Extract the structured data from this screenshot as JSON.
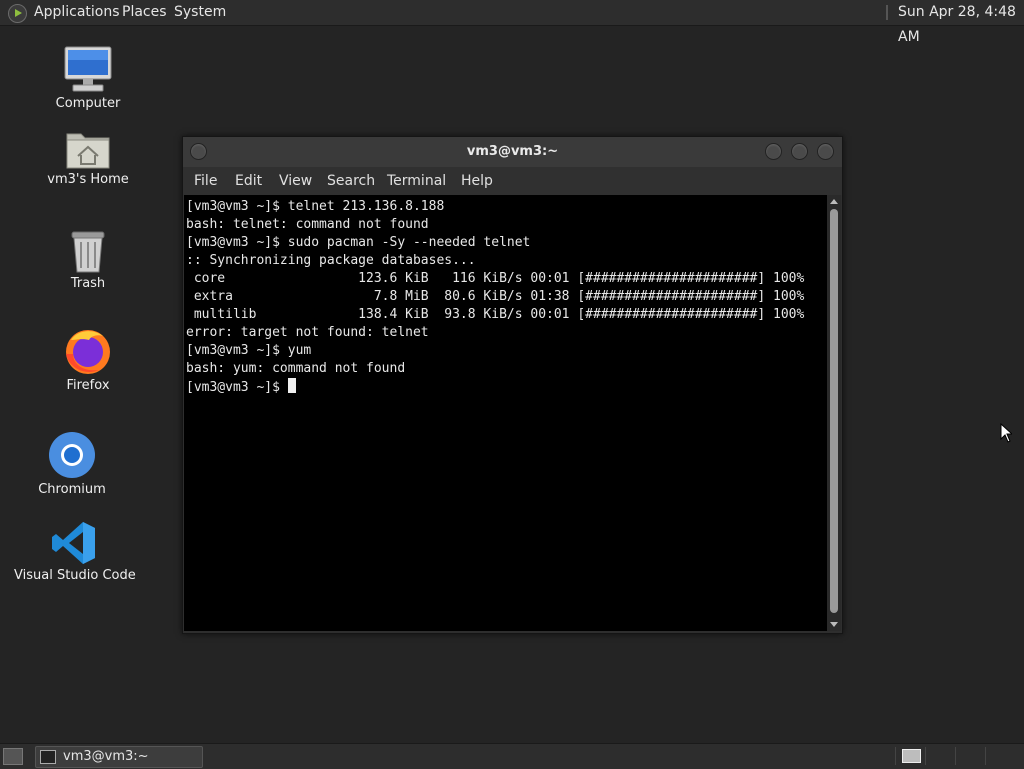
{
  "topbar": {
    "menus": [
      "Applications",
      "Places",
      "System"
    ],
    "clock": "Sun Apr 28,  4:48 AM"
  },
  "desktop": {
    "icons": [
      {
        "label": "Computer",
        "icon": "computer-icon"
      },
      {
        "label": "vm3's Home",
        "icon": "home-folder-icon"
      },
      {
        "label": "Trash",
        "icon": "trash-icon"
      },
      {
        "label": "Firefox",
        "icon": "firefox-icon"
      },
      {
        "label": "Chromium",
        "icon": "chromium-icon"
      },
      {
        "label": "Visual Studio Code",
        "icon": "vscode-icon"
      }
    ]
  },
  "terminal_window": {
    "title": "vm3@vm3:~",
    "menu": [
      "File",
      "Edit",
      "View",
      "Search",
      "Terminal",
      "Help"
    ],
    "lines": [
      "[vm3@vm3 ~]$ telnet 213.136.8.188",
      "bash: telnet: command not found",
      "[vm3@vm3 ~]$ sudo pacman -Sy --needed telnet",
      ":: Synchronizing package databases...",
      " core                 123.6 KiB   116 KiB/s 00:01 [######################] 100%",
      " extra                  7.8 MiB  80.6 KiB/s 01:38 [######################] 100%",
      " multilib             138.4 KiB  93.8 KiB/s 00:01 [######################] 100%",
      "error: target not found: telnet",
      "[vm3@vm3 ~]$ yum",
      "bash: yum: command not found"
    ],
    "prompt": "[vm3@vm3 ~]$ "
  },
  "taskbar": {
    "task_label": "vm3@vm3:~"
  },
  "colors": {
    "desktop_bg": "#242424",
    "panel_bg": "#2d2d2d",
    "terminal_bg": "#000000",
    "terminal_fg": "#e8e8e8"
  }
}
